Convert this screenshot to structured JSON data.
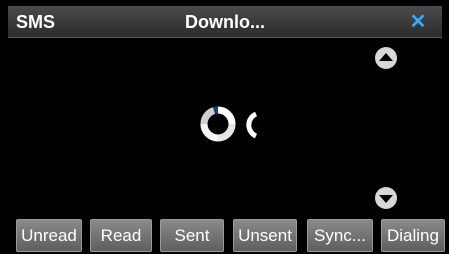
{
  "header": {
    "left_label": "SMS",
    "title": "Downlo...",
    "close_icon": "close-icon"
  },
  "scroll": {
    "up_icon": "chevron-up-icon",
    "down_icon": "chevron-down-icon"
  },
  "spinner": {
    "icon": "loading-spinner-icon"
  },
  "tabs": [
    {
      "label": "Unread"
    },
    {
      "label": "Read"
    },
    {
      "label": "Sent"
    },
    {
      "label": "Unsent"
    },
    {
      "label": "Sync..."
    },
    {
      "label": "Dialing"
    }
  ],
  "colors": {
    "close": "#3aa7ff",
    "background": "#000000",
    "tab_fill": "#727272",
    "header_fill": "#3a3a3a"
  }
}
